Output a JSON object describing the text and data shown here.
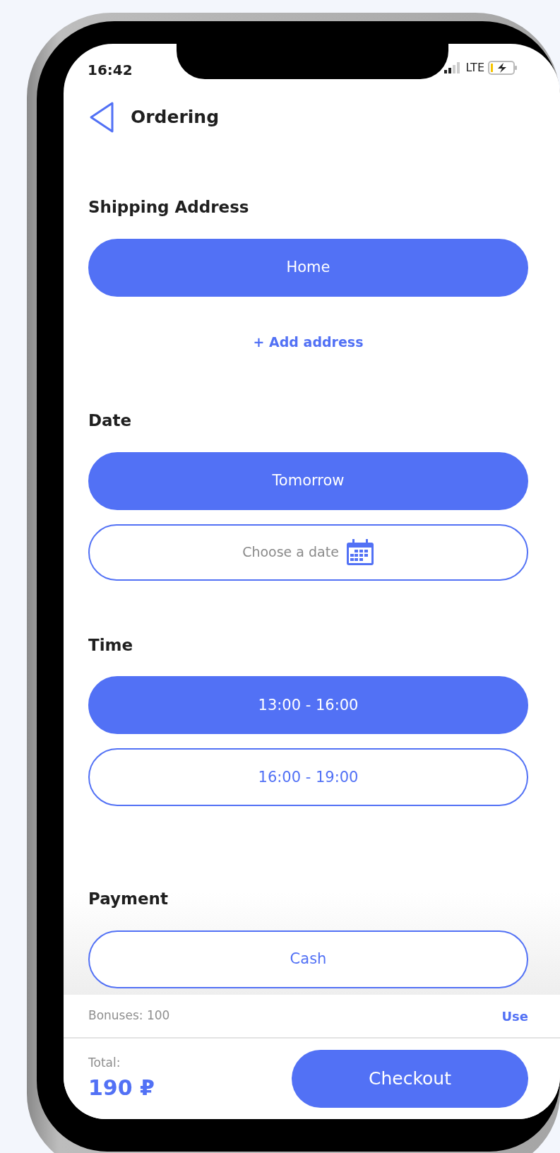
{
  "status_bar": {
    "time": "16:42",
    "network": "LTE"
  },
  "header": {
    "title": "Ordering"
  },
  "sections": [
    {
      "heading": "Shipping Address",
      "options": [
        {
          "kind": "choice",
          "label": "Home",
          "selected": true
        }
      ],
      "link": "+ Add address"
    },
    {
      "heading": "Date",
      "options": [
        {
          "kind": "choice",
          "label": "Tomorrow",
          "selected": true
        },
        {
          "kind": "date-picker",
          "label": "Choose a date",
          "selected": false
        }
      ]
    },
    {
      "heading": "Time",
      "options": [
        {
          "kind": "choice",
          "label": "13:00 - 16:00",
          "selected": true
        },
        {
          "kind": "choice",
          "label": "16:00 - 19:00",
          "selected": false
        }
      ]
    },
    {
      "heading": "Payment",
      "options": [
        {
          "kind": "choice",
          "label": "Cash",
          "selected": false
        }
      ]
    }
  ],
  "footer": {
    "bonuses": "Bonuses: 100",
    "use_link": "Use",
    "total_label": "Total:",
    "total": "190 ₽",
    "checkout": "Checkout"
  }
}
